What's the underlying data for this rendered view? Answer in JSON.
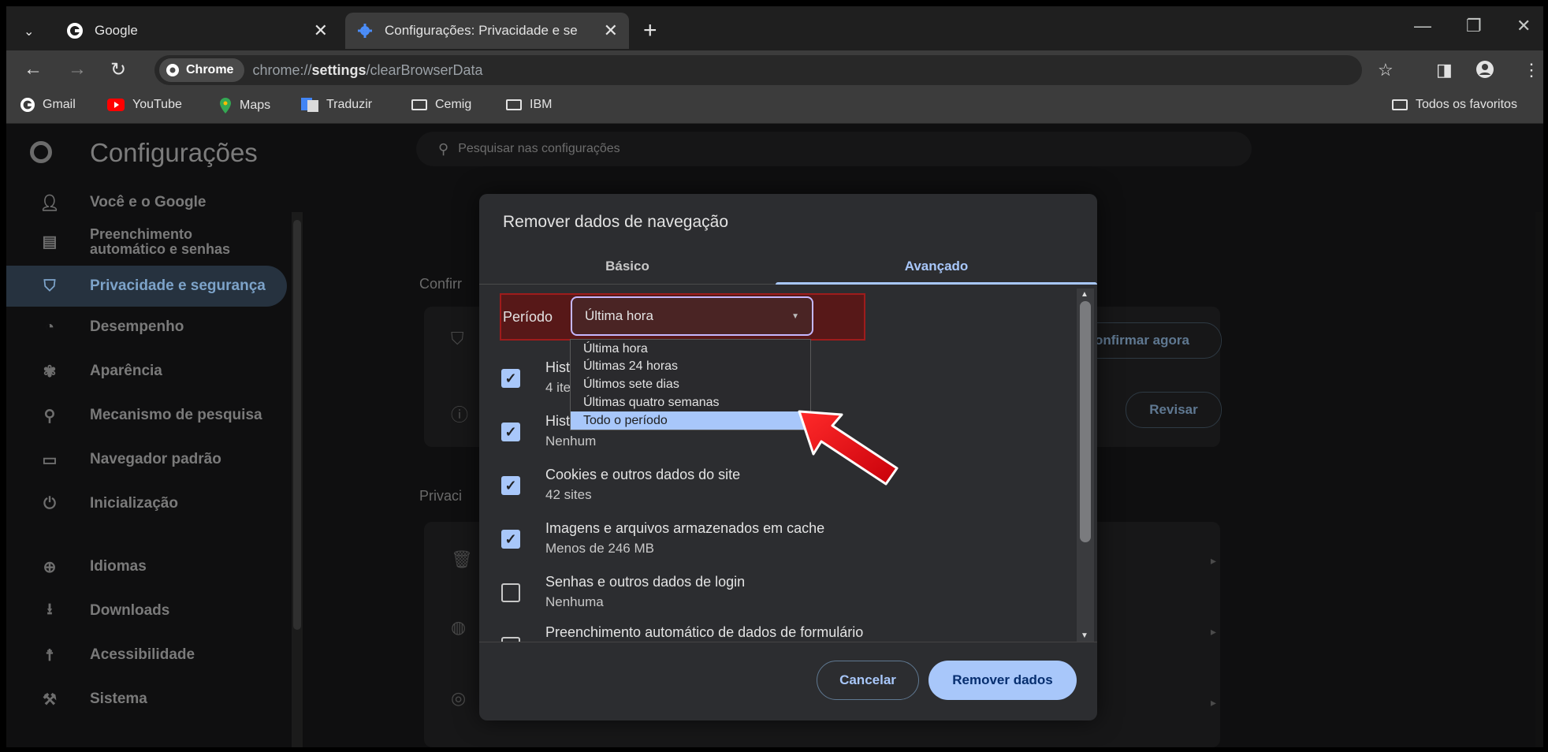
{
  "tabs": [
    {
      "title": "Google",
      "close": "✕"
    },
    {
      "title": "Configurações: Privacidade e se",
      "close": "✕"
    }
  ],
  "toolbar": {
    "chip": "Chrome",
    "url_prefix": "chrome://",
    "url_bold": "settings",
    "url_suffix": "/clearBrowserData"
  },
  "bookmarks": [
    {
      "label": "Gmail",
      "icon": "google-icon"
    },
    {
      "label": "YouTube",
      "icon": "youtube-icon"
    },
    {
      "label": "Maps",
      "icon": "maps-icon"
    },
    {
      "label": "Traduzir",
      "icon": "translate-icon"
    },
    {
      "label": "Cemig",
      "icon": "folder-icon"
    },
    {
      "label": "IBM",
      "icon": "folder-icon"
    }
  ],
  "all_bookmarks": "Todos os favoritos",
  "settings": {
    "title": "Configurações",
    "search_placeholder": "Pesquisar nas configurações",
    "nav": [
      {
        "label": "Você e o Google",
        "icon": "person-icon"
      },
      {
        "label": "Preenchimento automático e senhas",
        "line1": "Preenchimento",
        "line2": "automático e senhas",
        "icon": "clipboard-icon"
      },
      {
        "label": "Privacidade e segurança",
        "icon": "shield-icon"
      },
      {
        "label": "Desempenho",
        "icon": "speedometer-icon"
      },
      {
        "label": "Aparência",
        "icon": "palette-icon"
      },
      {
        "label": "Mecanismo de pesquisa",
        "icon": "search-icon"
      },
      {
        "label": "Navegador padrão",
        "icon": "browser-icon"
      },
      {
        "label": "Inicialização",
        "icon": "power-icon"
      },
      {
        "label": "Idiomas",
        "icon": "globe-icon"
      },
      {
        "label": "Downloads",
        "icon": "download-icon"
      },
      {
        "label": "Acessibilidade",
        "icon": "accessibility-icon"
      },
      {
        "label": "Sistema",
        "icon": "wrench-icon"
      }
    ],
    "section1": "Confirr",
    "section2": "Privaci",
    "confirm_btn": "onfirmar agora",
    "review_btn": "Revisar"
  },
  "dialog": {
    "title": "Remover dados de navegação",
    "tab_basic": "Básico",
    "tab_advanced": "Avançado",
    "period_label": "Período",
    "period_value": "Última hora",
    "options": [
      "Última hora",
      "Últimas 24 horas",
      "Últimos sete dias",
      "Últimas quatro semanas",
      "Todo o período"
    ],
    "highlighted_option": "Todo o período",
    "items": [
      {
        "title": "Hist",
        "sub": "4 ite",
        "checked": true
      },
      {
        "title": "Hist",
        "sub": "Nenhum",
        "checked": true
      },
      {
        "title": "Cookies e outros dados do site",
        "sub": "42 sites",
        "checked": true
      },
      {
        "title": "Imagens e arquivos armazenados em cache",
        "sub": "Menos de 246 MB",
        "checked": true
      },
      {
        "title": "Senhas e outros dados de login",
        "sub": "Nenhuma",
        "checked": false
      },
      {
        "title": "Preenchimento automático de dados de formulário",
        "sub": "",
        "checked": false
      }
    ],
    "cancel": "Cancelar",
    "remove": "Remover dados"
  },
  "colors": {
    "accent": "#a8c7fa",
    "highlight_box": "#9e1c1c",
    "arrow": "#e0121b"
  }
}
